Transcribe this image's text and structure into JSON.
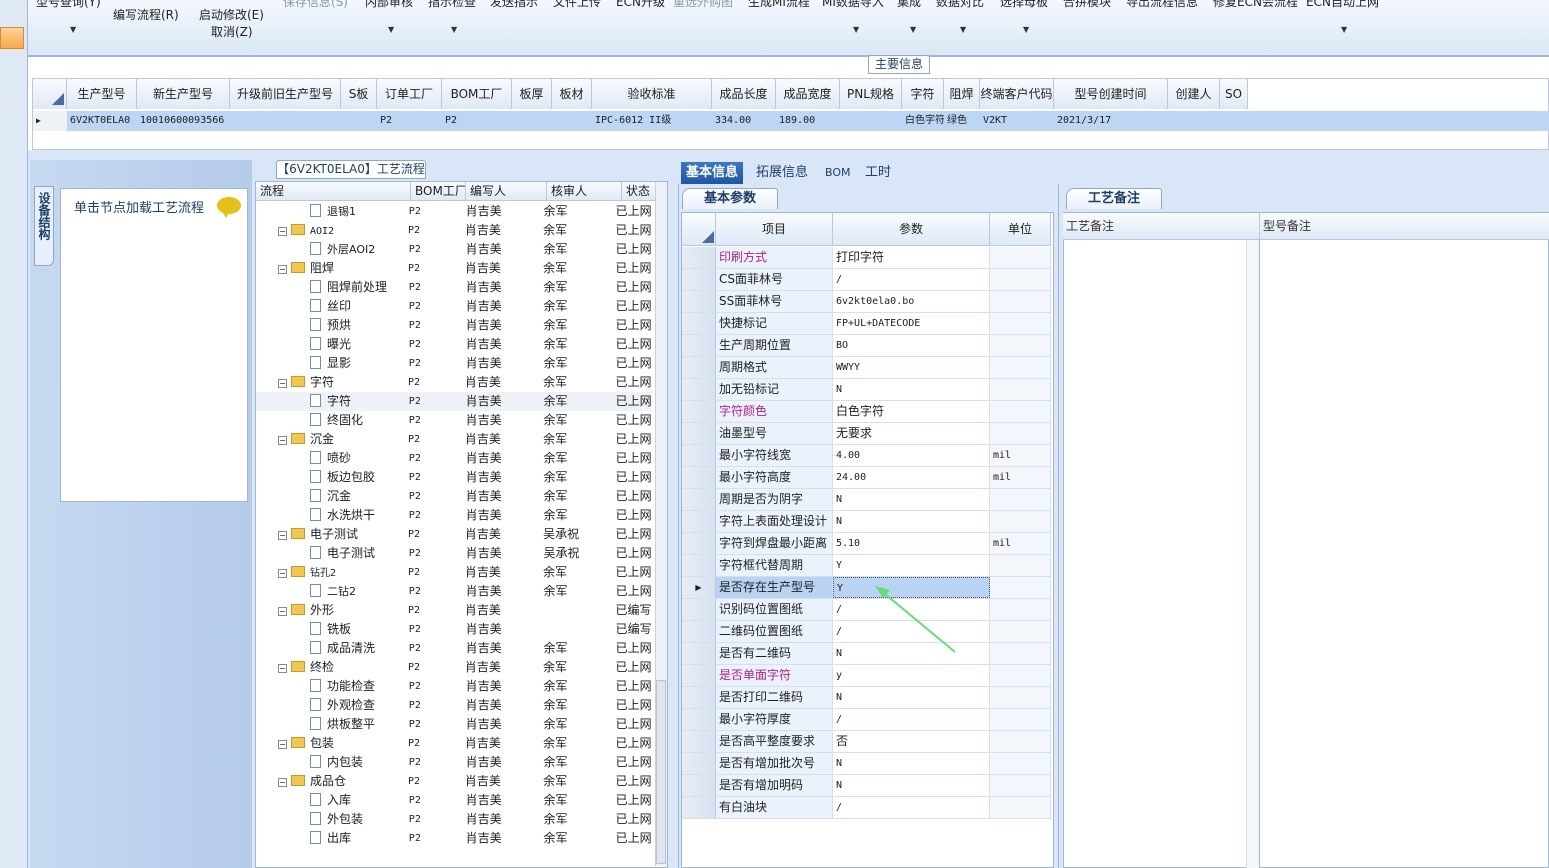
{
  "toolbar": {
    "items_top": [
      {
        "label": "型号查询(Y)",
        "dim": false
      },
      {
        "label": "保存信息(S)",
        "dim": true
      },
      {
        "label": "内部审核",
        "dim": false
      },
      {
        "label": "指示检查",
        "dim": false
      },
      {
        "label": "发送指示",
        "dim": false
      },
      {
        "label": "文件上传",
        "dim": false
      },
      {
        "label": "ECN升级",
        "dim": false
      },
      {
        "label": "重选外购图",
        "dim": true
      },
      {
        "label": "生成MI流程",
        "dim": false
      },
      {
        "label": "MI数据导入",
        "dim": false
      },
      {
        "label": "集成",
        "dim": false
      },
      {
        "label": "数据对比",
        "dim": false
      },
      {
        "label": "选择母板",
        "dim": false
      },
      {
        "label": "合拼模块",
        "dim": false
      },
      {
        "label": "导出流程信息",
        "dim": false
      },
      {
        "label": "修复ECN会流程",
        "dim": false
      },
      {
        "label": "ECN自动上网",
        "dim": false
      }
    ],
    "edit_flow": "编写流程(R)",
    "start_modify": "启动修改(E)",
    "cancel": "取消(Z)"
  },
  "main_info": {
    "label": "主要信息",
    "columns": [
      "生产型号",
      "新生产型号",
      "升级前旧生产型号",
      "S板",
      "订单工厂",
      "BOM工厂",
      "板厚",
      "板材",
      "验收标准",
      "成品长度",
      "成品宽度",
      "PNL规格",
      "字符",
      "阻焊",
      "终端客户代码",
      "型号创建时间",
      "创建人",
      "SO"
    ],
    "row": [
      "6V2KT0ELA0",
      "10010600093566",
      "",
      "",
      "P2",
      "P2",
      "",
      "",
      "IPC-6012 II级",
      "334.00",
      "189.00",
      "",
      "白色字符",
      "绿色",
      "V2KT",
      "2021/3/17",
      "",
      ""
    ]
  },
  "nav": {
    "tab": "设备结构",
    "hint": "单击节点加载工艺流程"
  },
  "tree": {
    "label": "【6V2KT0ELA0】工艺流程",
    "columns": [
      "流程",
      "BOM工厂",
      "编写人",
      "核审人",
      "状态"
    ],
    "rows": [
      {
        "name": "退锡1",
        "folder": false,
        "bom": "P2",
        "writer": "肖吉美",
        "reviewer": "余军",
        "status": "已上网"
      },
      {
        "name": "AOI2",
        "folder": true,
        "bom": "P2",
        "writer": "肖吉美",
        "reviewer": "余军",
        "status": "已上网"
      },
      {
        "name": "外层AOI2",
        "folder": false,
        "bom": "P2",
        "writer": "肖吉美",
        "reviewer": "余军",
        "status": "已上网"
      },
      {
        "name": "阻焊",
        "folder": true,
        "bom": "P2",
        "writer": "肖吉美",
        "reviewer": "余军",
        "status": "已上网"
      },
      {
        "name": "阻焊前处理",
        "folder": false,
        "bom": "P2",
        "writer": "肖吉美",
        "reviewer": "余军",
        "status": "已上网"
      },
      {
        "name": "丝印",
        "folder": false,
        "bom": "P2",
        "writer": "肖吉美",
        "reviewer": "余军",
        "status": "已上网"
      },
      {
        "name": "预烘",
        "folder": false,
        "bom": "P2",
        "writer": "肖吉美",
        "reviewer": "余军",
        "status": "已上网"
      },
      {
        "name": "曝光",
        "folder": false,
        "bom": "P2",
        "writer": "肖吉美",
        "reviewer": "余军",
        "status": "已上网"
      },
      {
        "name": "显影",
        "folder": false,
        "bom": "P2",
        "writer": "肖吉美",
        "reviewer": "余军",
        "status": "已上网"
      },
      {
        "name": "字符",
        "folder": true,
        "bom": "P2",
        "writer": "肖吉美",
        "reviewer": "余军",
        "status": "已上网"
      },
      {
        "name": "字符",
        "folder": false,
        "bom": "P2",
        "writer": "肖吉美",
        "reviewer": "余军",
        "status": "已上网",
        "selected": true
      },
      {
        "name": "终固化",
        "folder": false,
        "bom": "P2",
        "writer": "肖吉美",
        "reviewer": "余军",
        "status": "已上网"
      },
      {
        "name": "沉金",
        "folder": true,
        "bom": "P2",
        "writer": "肖吉美",
        "reviewer": "余军",
        "status": "已上网"
      },
      {
        "name": "喷砂",
        "folder": false,
        "bom": "P2",
        "writer": "肖吉美",
        "reviewer": "余军",
        "status": "已上网"
      },
      {
        "name": "板边包胶",
        "folder": false,
        "bom": "P2",
        "writer": "肖吉美",
        "reviewer": "余军",
        "status": "已上网"
      },
      {
        "name": "沉金",
        "folder": false,
        "bom": "P2",
        "writer": "肖吉美",
        "reviewer": "余军",
        "status": "已上网"
      },
      {
        "name": "水洗烘干",
        "folder": false,
        "bom": "P2",
        "writer": "肖吉美",
        "reviewer": "余军",
        "status": "已上网"
      },
      {
        "name": "电子测试",
        "folder": true,
        "bom": "P2",
        "writer": "肖吉美",
        "reviewer": "吴承祝",
        "status": "已上网"
      },
      {
        "name": "电子测试",
        "folder": false,
        "bom": "P2",
        "writer": "肖吉美",
        "reviewer": "吴承祝",
        "status": "已上网"
      },
      {
        "name": "钻孔2",
        "folder": true,
        "bom": "P2",
        "writer": "肖吉美",
        "reviewer": "余军",
        "status": "已上网"
      },
      {
        "name": "二钻2",
        "folder": false,
        "bom": "P2",
        "writer": "肖吉美",
        "reviewer": "余军",
        "status": "已上网"
      },
      {
        "name": "外形",
        "folder": true,
        "bom": "P2",
        "writer": "肖吉美",
        "reviewer": "",
        "status": "已编写"
      },
      {
        "name": "铣板",
        "folder": false,
        "bom": "P2",
        "writer": "肖吉美",
        "reviewer": "",
        "status": "已编写"
      },
      {
        "name": "成品清洗",
        "folder": false,
        "bom": "P2",
        "writer": "肖吉美",
        "reviewer": "余军",
        "status": "已上网"
      },
      {
        "name": "终检",
        "folder": true,
        "bom": "P2",
        "writer": "肖吉美",
        "reviewer": "余军",
        "status": "已上网"
      },
      {
        "name": "功能检查",
        "folder": false,
        "bom": "P2",
        "writer": "肖吉美",
        "reviewer": "余军",
        "status": "已上网"
      },
      {
        "name": "外观检查",
        "folder": false,
        "bom": "P2",
        "writer": "肖吉美",
        "reviewer": "余军",
        "status": "已上网"
      },
      {
        "name": "烘板整平",
        "folder": false,
        "bom": "P2",
        "writer": "肖吉美",
        "reviewer": "余军",
        "status": "已上网"
      },
      {
        "name": "包装",
        "folder": true,
        "bom": "P2",
        "writer": "肖吉美",
        "reviewer": "余军",
        "status": "已上网"
      },
      {
        "name": "内包装",
        "folder": false,
        "bom": "P2",
        "writer": "肖吉美",
        "reviewer": "余军",
        "status": "已上网"
      },
      {
        "name": "成品仓",
        "folder": true,
        "bom": "P2",
        "writer": "肖吉美",
        "reviewer": "余军",
        "status": "已上网"
      },
      {
        "name": "入库",
        "folder": false,
        "bom": "P2",
        "writer": "肖吉美",
        "reviewer": "余军",
        "status": "已上网"
      },
      {
        "name": "外包装",
        "folder": false,
        "bom": "P2",
        "writer": "肖吉美",
        "reviewer": "余军",
        "status": "已上网"
      },
      {
        "name": "出库",
        "folder": false,
        "bom": "P2",
        "writer": "肖吉美",
        "reviewer": "余军",
        "status": "已上网"
      }
    ]
  },
  "detail_tabs": [
    "基本信息",
    "拓展信息",
    "BOM",
    "工时"
  ],
  "basic": {
    "tab": "基本参数",
    "columns": [
      "项目",
      "参数",
      "单位"
    ],
    "rows": [
      {
        "item": "印刷方式",
        "value": "打印字符",
        "unit": "",
        "highlight": true
      },
      {
        "item": "CS面菲林号",
        "value": "/",
        "unit": ""
      },
      {
        "item": "SS面菲林号",
        "value": "6v2kt0ela0.bo",
        "unit": ""
      },
      {
        "item": "快捷标记",
        "value": "FP+UL+DATECODE",
        "unit": ""
      },
      {
        "item": "生产周期位置",
        "value": "BO",
        "unit": ""
      },
      {
        "item": "周期格式",
        "value": "WWYY",
        "unit": ""
      },
      {
        "item": "加无铅标记",
        "value": "N",
        "unit": ""
      },
      {
        "item": "字符颜色",
        "value": "白色字符",
        "unit": "",
        "highlight": true
      },
      {
        "item": "油墨型号",
        "value": "无要求",
        "unit": ""
      },
      {
        "item": "最小字符线宽",
        "value": "4.00",
        "unit": "mil"
      },
      {
        "item": "最小字符高度",
        "value": "24.00",
        "unit": "mil"
      },
      {
        "item": "周期是否为阴字",
        "value": "N",
        "unit": ""
      },
      {
        "item": "字符上表面处理设计",
        "value": "N",
        "unit": ""
      },
      {
        "item": "字符到焊盘最小距离",
        "value": "5.10",
        "unit": "mil"
      },
      {
        "item": "字符框代替周期",
        "value": "Y",
        "unit": ""
      },
      {
        "item": "是否存在生产型号",
        "value": "Y",
        "unit": "",
        "selected": true
      },
      {
        "item": "识别码位置图纸",
        "value": "/",
        "unit": ""
      },
      {
        "item": "二维码位置图纸",
        "value": "/",
        "unit": ""
      },
      {
        "item": "是否有二维码",
        "value": "N",
        "unit": ""
      },
      {
        "item": "是否单面字符",
        "value": "y",
        "unit": "",
        "highlight": true
      },
      {
        "item": "是否打印二维码",
        "value": "N",
        "unit": ""
      },
      {
        "item": "最小字符厚度",
        "value": "/",
        "unit": ""
      },
      {
        "item": "是否高平整度要求",
        "value": "否",
        "unit": ""
      },
      {
        "item": "是否有增加批次号",
        "value": "N",
        "unit": ""
      },
      {
        "item": "是否有增加明码",
        "value": "N",
        "unit": ""
      },
      {
        "item": "有白油块",
        "value": "/",
        "unit": ""
      }
    ]
  },
  "remarks": {
    "tab": "工艺备注",
    "col1": "工艺备注",
    "col2": "型号备注"
  },
  "colors": {
    "accent": "#1f56a8",
    "highlight_text": "#b2228b",
    "selection": "#bcd6f4",
    "arrow": "#66dd77"
  }
}
